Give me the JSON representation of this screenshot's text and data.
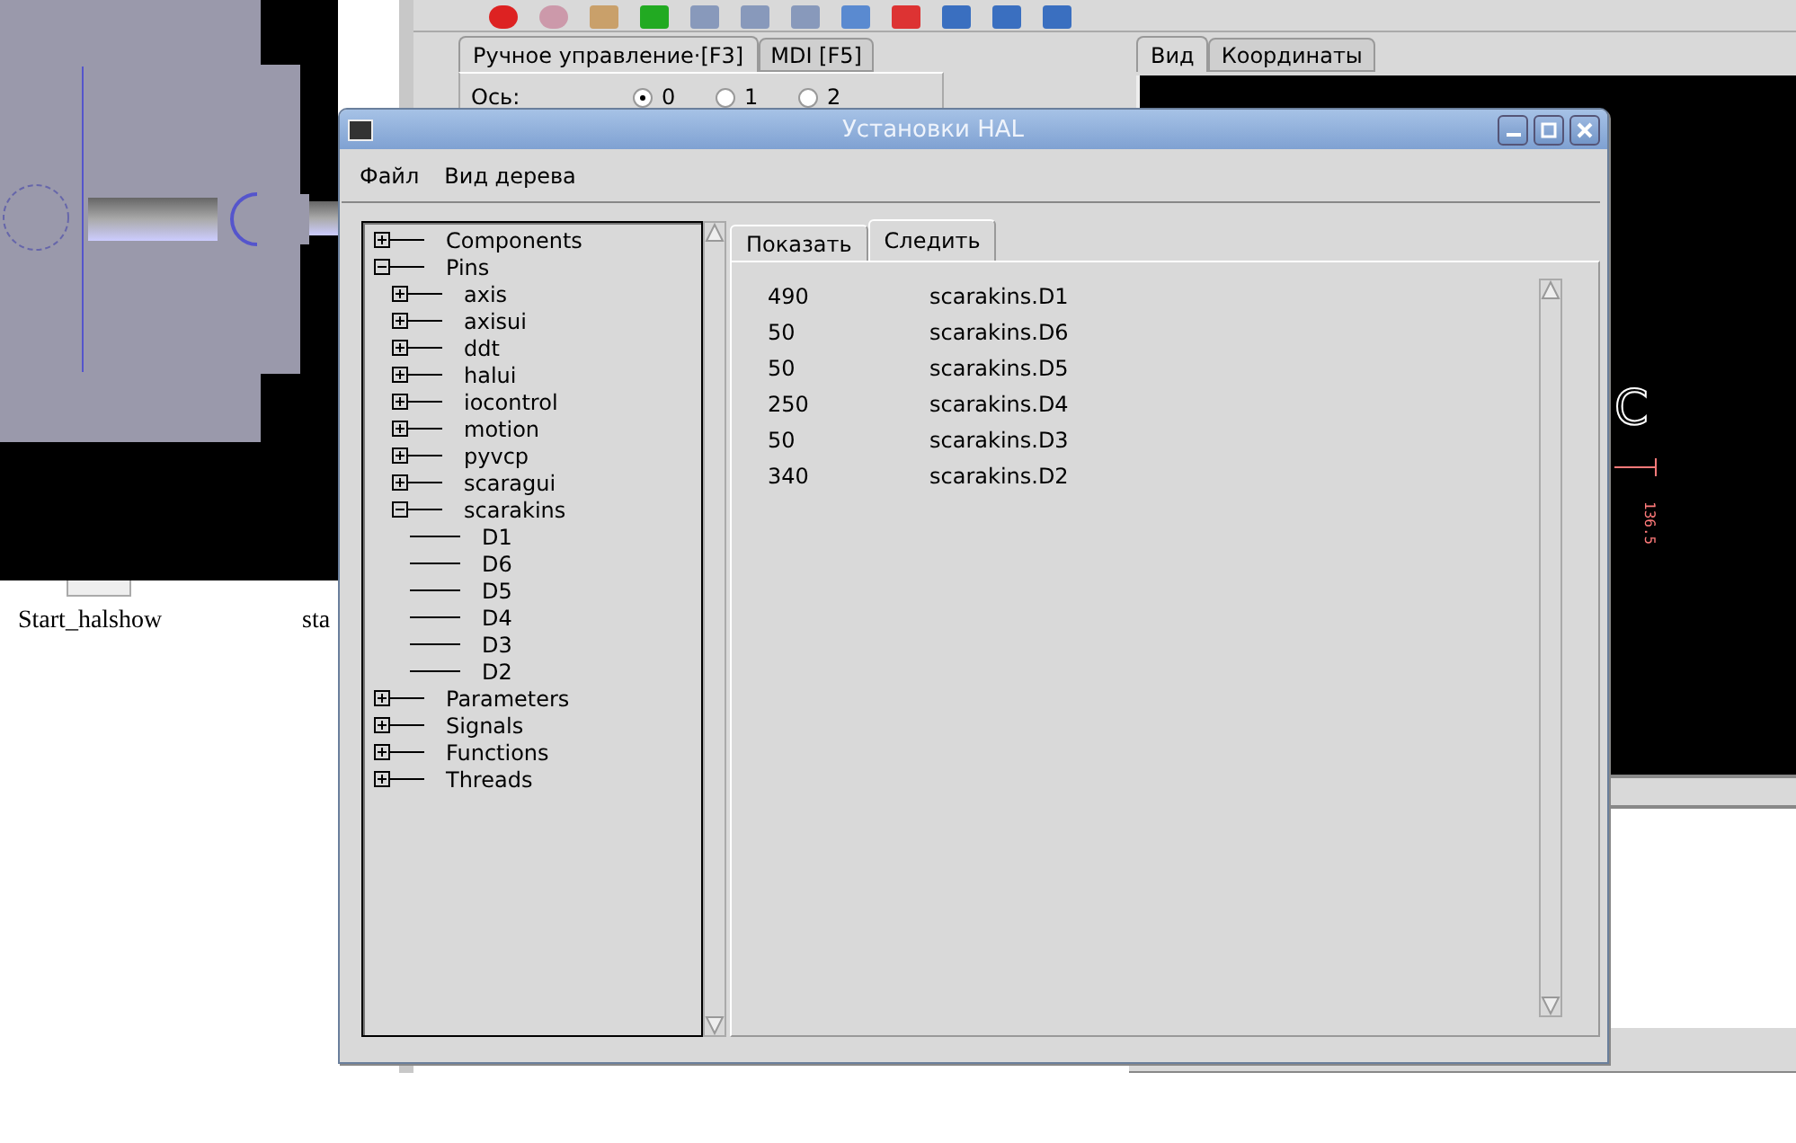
{
  "background": {
    "launcher_labels": [
      "Start_halshow",
      "sta"
    ]
  },
  "axis_window": {
    "left_tabs": [
      {
        "label": "Ручное управление·[F3]",
        "selected": true
      },
      {
        "label": "MDI [F5]",
        "selected": false
      }
    ],
    "axis_label": "Ось:",
    "axis_options": [
      {
        "label": "0",
        "selected": true
      },
      {
        "label": "1",
        "selected": false
      },
      {
        "label": "2",
        "selected": false
      }
    ],
    "right_tabs": [
      {
        "label": "Вид",
        "selected": true
      },
      {
        "label": "Координаты",
        "selected": false
      }
    ],
    "preview": {
      "axis_letter": "C",
      "dimension": "136.5"
    }
  },
  "hal_window": {
    "title": "Установки HAL",
    "menu": [
      "Файл",
      "Вид дерева"
    ],
    "tree": [
      {
        "label": "Components",
        "expanded": false
      },
      {
        "label": "Pins",
        "expanded": true,
        "children": [
          {
            "label": "axis",
            "expanded": false
          },
          {
            "label": "axisui",
            "expanded": false
          },
          {
            "label": "ddt",
            "expanded": false
          },
          {
            "label": "halui",
            "expanded": false
          },
          {
            "label": "iocontrol",
            "expanded": false
          },
          {
            "label": "motion",
            "expanded": false
          },
          {
            "label": "pyvcp",
            "expanded": false
          },
          {
            "label": "scaragui",
            "expanded": false
          },
          {
            "label": "scarakins",
            "expanded": true,
            "children": [
              {
                "label": "D1"
              },
              {
                "label": "D6"
              },
              {
                "label": "D5"
              },
              {
                "label": "D4"
              },
              {
                "label": "D3"
              },
              {
                "label": "D2"
              }
            ]
          }
        ]
      },
      {
        "label": "Parameters",
        "expanded": false
      },
      {
        "label": "Signals",
        "expanded": false
      },
      {
        "label": "Functions",
        "expanded": false
      },
      {
        "label": "Threads",
        "expanded": false
      }
    ],
    "tabs": [
      {
        "label": "Показать",
        "selected": false
      },
      {
        "label": "Следить",
        "selected": true
      }
    ],
    "watch_rows": [
      {
        "value": "490",
        "name": "scarakins.D1"
      },
      {
        "value": "50",
        "name": "scarakins.D6"
      },
      {
        "value": "50",
        "name": "scarakins.D5"
      },
      {
        "value": "250",
        "name": "scarakins.D4"
      },
      {
        "value": "50",
        "name": "scarakins.D3"
      },
      {
        "value": "340",
        "name": "scarakins.D2"
      }
    ]
  }
}
